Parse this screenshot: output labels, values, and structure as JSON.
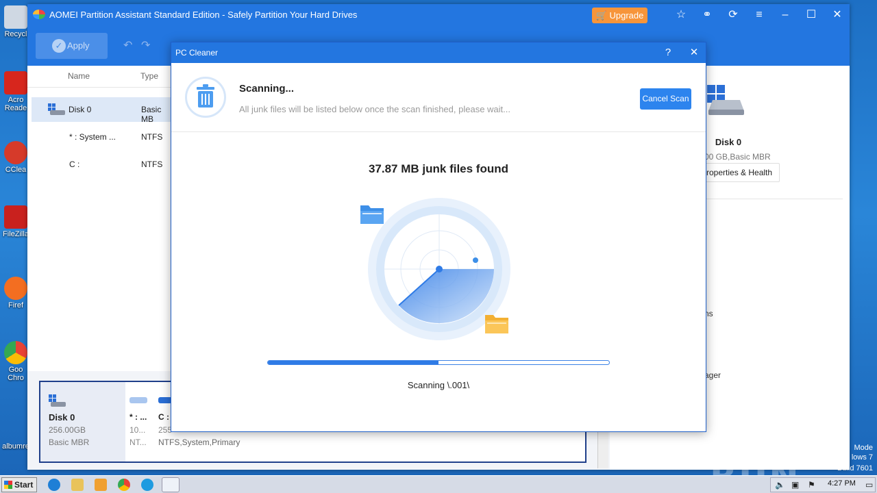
{
  "desktop": {
    "icons": [
      {
        "label": "Recycl",
        "color": "#cfd8e3"
      },
      {
        "label": "Acro Reade",
        "color": "#d7261d"
      },
      {
        "label": "CCleа",
        "color": "#d63a2a"
      },
      {
        "label": "FileZilla",
        "color": "#c9211e"
      },
      {
        "label": "Firef",
        "color": "#f36e21"
      },
      {
        "label": "Goo Chro",
        "color": "#34a853"
      },
      {
        "label": "albumre",
        "color": "#1d6fc4"
      }
    ],
    "watermark": "ANY RUN",
    "winver_line1": "Mode",
    "winver_line2": "lows 7",
    "winver_line3": "Build 7601"
  },
  "app": {
    "title": "AOMEI Partition Assistant Standard Edition - Safely Partition Your Hard Drives",
    "upgrade_label": "Upgrade",
    "apply_label": "Apply",
    "columns": {
      "name": "Name",
      "type": "Type"
    },
    "rows": [
      {
        "name": "Disk 0",
        "type": "Basic MB"
      },
      {
        "name": "* : System ...",
        "type": "NTFS"
      },
      {
        "name": "C :",
        "type": "NTFS"
      }
    ],
    "right_panel": {
      "disk_name": "Disk 0",
      "disk_info": "00 GB,Basic MBR",
      "props_button": "roperties & Health",
      "link1": "ns",
      "link2": "ager"
    },
    "disk_card": {
      "name": "Disk 0",
      "size": "256.00GB",
      "type": "Basic MBR",
      "partitions": [
        {
          "label": "* : ...",
          "size": "10...",
          "fs": "NT..."
        },
        {
          "label": "C :",
          "size": "255",
          "fs": "NTFS,System,Primary"
        }
      ]
    }
  },
  "dialog": {
    "title": "PC Cleaner",
    "help": "?",
    "close": "✕",
    "scan_title": "Scanning...",
    "scan_subtitle": "All junk files will be listed below once the scan finished, please wait...",
    "cancel_label": "Cancel Scan",
    "found_text": "37.87 MB junk files found",
    "progress_fraction": 0.5,
    "scan_path": "Scanning \\.001\\"
  },
  "taskbar": {
    "start_label": "Start",
    "clock": "4:27 PM"
  },
  "colors": {
    "accent": "#2376e0",
    "upgrade": "#f7953a",
    "progress": "#2f7be6"
  }
}
